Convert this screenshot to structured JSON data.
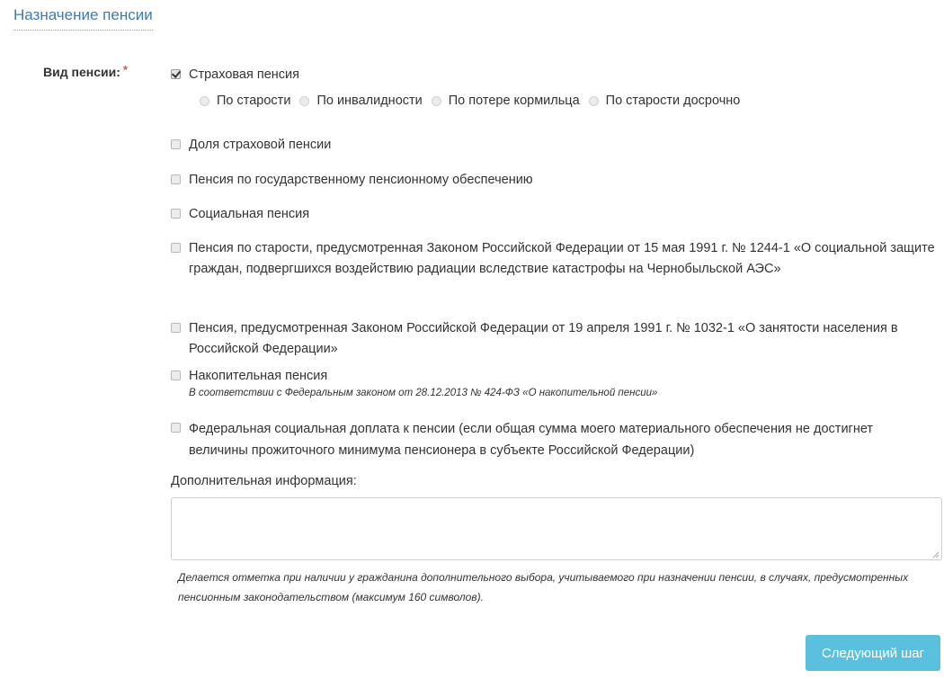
{
  "section": {
    "title": "Назначение пенсии"
  },
  "pension_type": {
    "label": "Вид пенсии:",
    "required_mark": "*",
    "options": [
      {
        "label": "Страховая пенсия",
        "checked": true
      },
      {
        "label": "Доля страховой пенсии",
        "checked": false
      },
      {
        "label": "Пенсия по государственному пенсионному обеспечению",
        "checked": false
      },
      {
        "label": "Социальная пенсия",
        "checked": false
      },
      {
        "label": "Пенсия по старости, предусмотренная Законом Российской Федерации от 15 мая 1991 г. № 1244-1 «О социальной защите граждан, подвергшихся воздействию радиации вследствие катастрофы на Чернобыльской АЭС»",
        "checked": false
      },
      {
        "label": "Пенсия, предусмотренная Законом Российской Федерации от 19 апреля 1991 г. № 1032-1 «О занятости населения в Российской Федерации»",
        "checked": false
      },
      {
        "label": "Накопительная пенсия",
        "checked": false,
        "note": "В соответствии с Федеральным законом от 28.12.2013 № 424-ФЗ «О накопительной пенсии»"
      },
      {
        "label": "Федеральная социальная доплата к пенсии (если общая сумма моего материального обеспечения не достигнет величины прожиточного минимума пенсионера в субъекте Российской Федерации)",
        "checked": false
      }
    ],
    "insurance_suboptions": [
      {
        "label": "По старости",
        "selected": false
      },
      {
        "label": "По инвалидности",
        "selected": false
      },
      {
        "label": "По потере кормильца",
        "selected": false
      },
      {
        "label": "По старости досрочно",
        "selected": false
      }
    ]
  },
  "additional_info": {
    "label": "Дополнительная информация:",
    "value": "",
    "help": "Делается отметка при наличии у гражданина дополнительного выбора, учитываемого при назначении пенсии, в случаях, предусмотренных пенсионным законодательством (максимум 160 символов)."
  },
  "actions": {
    "next_label": "Следующий шаг"
  },
  "colors": {
    "title": "#3a7cb5",
    "required": "#d9534f",
    "button": "#5bc0de"
  }
}
